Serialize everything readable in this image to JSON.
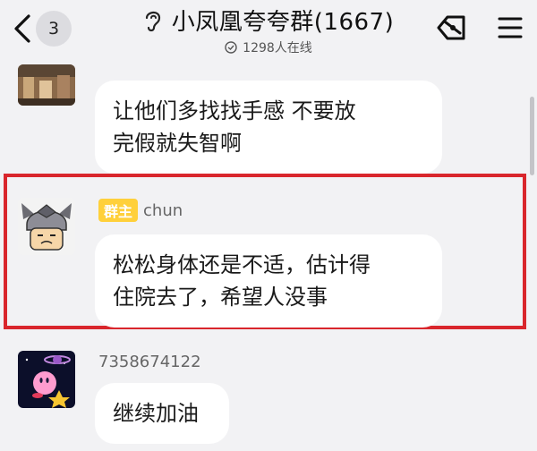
{
  "header": {
    "unread_count": "3",
    "title": "小凤凰夸夸群(1667)",
    "online_text": "1298人在线",
    "icons": [
      "back-chevron-icon",
      "ear-icon",
      "clock-icon",
      "tag-icon",
      "menu-icon"
    ]
  },
  "messages": [
    {
      "sender": "",
      "text_line1": "让他们多找找手感 不要放",
      "text_line2": "完假就失智啊"
    },
    {
      "role_badge": "群主",
      "sender": "chun",
      "text_line1": "松松身体还是不适，估计得",
      "text_line2": "住院去了，希望人没事",
      "highlighted": true
    },
    {
      "sender": "7358674122",
      "text_line1": "继续加油"
    }
  ],
  "colors": {
    "highlight": "#d9262c",
    "badge": "#ffd03b",
    "background": "#f2f2f4",
    "bubble": "#ffffff"
  }
}
